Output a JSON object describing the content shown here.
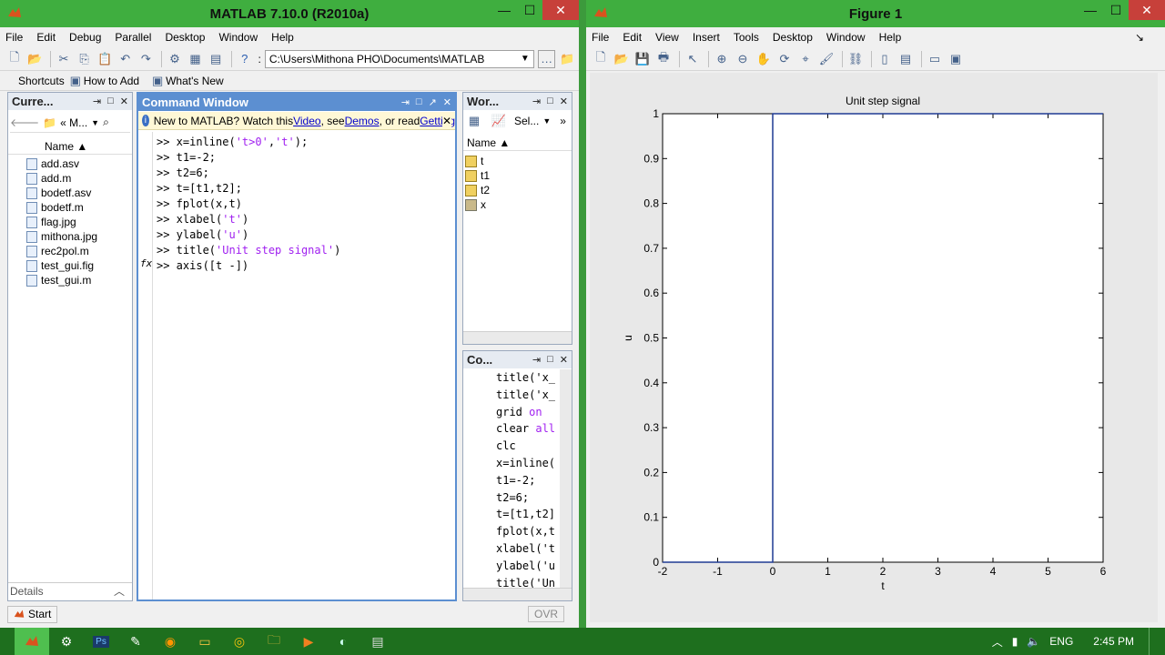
{
  "matlab": {
    "title": "MATLAB  7.10.0 (R2010a)",
    "menu": [
      "File",
      "Edit",
      "Debug",
      "Parallel",
      "Desktop",
      "Window",
      "Help"
    ],
    "path": "C:\\Users\\Mithona PHO\\Documents\\MATLAB",
    "shortcuts": {
      "label": "Shortcuts",
      "how_to_add": "How to Add",
      "whats_new": "What's New"
    },
    "current_folder": {
      "header": "Curre...",
      "crumb": "« M...",
      "col_name": "Name ▲",
      "files": [
        "add.asv",
        "add.m",
        "bodetf.asv",
        "bodetf.m",
        "flag.jpg",
        "mithona.jpg",
        "rec2pol.m",
        "test_gui.fig",
        "test_gui.m"
      ],
      "details": "Details"
    },
    "command_window": {
      "header": "Command Window",
      "notice": {
        "prefix": "New to MATLAB? Watch this ",
        "video": "Video",
        "mid": ", see ",
        "demos": "Demos",
        "mid2": ", or read ",
        "getting": "Getting"
      },
      "lines": [
        ">> x=inline('t>0','t');",
        ">> t1=-2;",
        ">> t2=6;",
        ">> t=[t1,t2];",
        ">> fplot(x,t)",
        ">> xlabel('t')",
        ">> ylabel('u')",
        ">> title('Unit step signal')",
        ">> axis([t -])"
      ],
      "fx": "fx"
    },
    "workspace": {
      "header": "Wor...",
      "select": "Sel...",
      "col_name": "Name ▲",
      "vars": [
        "t",
        "t1",
        "t2",
        "x"
      ]
    },
    "history": {
      "header": "Co...",
      "lines": [
        "title('x_",
        "title('x_",
        "grid on",
        "clear all",
        "clc",
        "x=inline(",
        "t1=-2;",
        "t2=6;",
        "t=[t1,t2]",
        "fplot(x,t",
        "xlabel('t",
        "ylabel('u",
        "title('Un"
      ]
    },
    "status": {
      "start": "Start",
      "ovr": "OVR"
    }
  },
  "figure": {
    "title": "Figure 1",
    "menu": [
      "File",
      "Edit",
      "View",
      "Insert",
      "Tools",
      "Desktop",
      "Window",
      "Help"
    ]
  },
  "chart_data": {
    "type": "line",
    "title": "Unit step signal",
    "xlabel": "t",
    "ylabel": "u",
    "xlim": [
      -2,
      6
    ],
    "ylim": [
      0,
      1
    ],
    "xticks": [
      "-2",
      "-1",
      "0",
      "1",
      "2",
      "3",
      "4",
      "5",
      "6"
    ],
    "yticks": [
      "0",
      "0.1",
      "0.2",
      "0.3",
      "0.4",
      "0.5",
      "0.6",
      "0.7",
      "0.8",
      "0.9",
      "1"
    ],
    "series": [
      {
        "x": [
          -2,
          0,
          0,
          6
        ],
        "y": [
          0,
          0,
          1,
          1
        ],
        "color": "#1f3a93"
      }
    ]
  },
  "taskbar": {
    "lang": "ENG",
    "time": "2:45 PM"
  },
  "colors": {
    "accent": "#3fae3f",
    "panel_active": "#5c8fd1"
  }
}
